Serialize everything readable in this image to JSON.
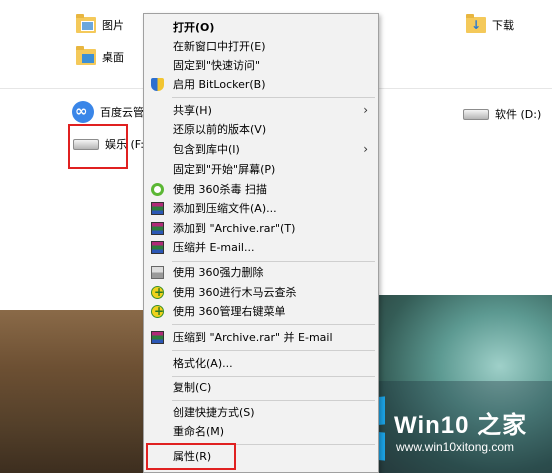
{
  "explorer": {
    "folders": [
      {
        "label": "图片",
        "icon": "pictures-folder-icon"
      },
      {
        "label": "下载",
        "icon": "downloads-folder-icon"
      },
      {
        "label": "桌面",
        "icon": "desktop-folder-icon"
      }
    ],
    "devices": [
      {
        "label": "百度云管家",
        "icon": "baidu-cloud-icon"
      },
      {
        "label": "软件 (D:)",
        "icon": "drive-icon"
      },
      {
        "label": "娱乐 (F:)",
        "icon": "drive-icon",
        "selected": true
      }
    ]
  },
  "context_menu": {
    "items": [
      {
        "label": "打开(O)",
        "bold": true
      },
      {
        "label": "在新窗口中打开(E)"
      },
      {
        "label": "固定到\"快速访问\""
      },
      {
        "label": "启用 BitLocker(B)",
        "icon": "bitlocker-shield-icon"
      },
      {
        "label": "共享(H)",
        "submenu": true
      },
      {
        "label": "还原以前的版本(V)"
      },
      {
        "label": "包含到库中(I)",
        "submenu": true
      },
      {
        "label": "固定到\"开始\"屏幕(P)"
      },
      {
        "label": "使用 360杀毒 扫描",
        "icon": "360-antivirus-icon"
      },
      {
        "label": "添加到压缩文件(A)...",
        "icon": "winrar-icon"
      },
      {
        "label": "添加到 \"Archive.rar\"(T)",
        "icon": "winrar-icon"
      },
      {
        "label": "压缩并 E-mail...",
        "icon": "winrar-icon"
      },
      {
        "label": "使用 360强力删除",
        "icon": "360-shredder-icon"
      },
      {
        "label": "使用 360进行木马云查杀",
        "icon": "360-trojan-scan-icon"
      },
      {
        "label": "使用 360管理右键菜单",
        "icon": "360-menu-manager-icon"
      },
      {
        "label": "压缩到 \"Archive.rar\" 并 E-mail",
        "icon": "winrar-icon"
      },
      {
        "label": "格式化(A)..."
      },
      {
        "label": "复制(C)"
      },
      {
        "label": "创建快捷方式(S)"
      },
      {
        "label": "重命名(M)"
      },
      {
        "label": "属性(R)",
        "highlighted": true
      }
    ]
  },
  "watermark": {
    "brand": "Win10 之家",
    "url": "www.win10xitong.com"
  },
  "colors": {
    "highlight_box": "#e02020",
    "win_blue": "#1ba1e2",
    "menu_bg": "#f2f2f2"
  }
}
